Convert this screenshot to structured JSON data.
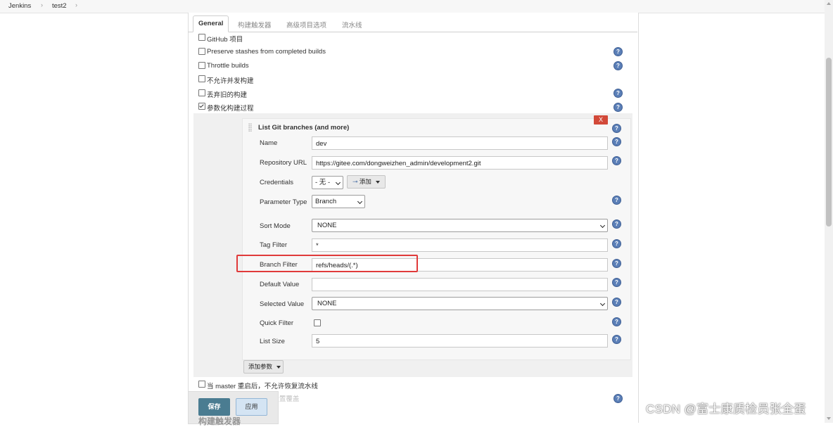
{
  "breadcrumb": [
    "Jenkins",
    "test2"
  ],
  "tabs": [
    "General",
    "构建触发器",
    "高级项目选项",
    "流水线"
  ],
  "options": [
    {
      "label": "GitHub 项目",
      "checked": false,
      "help": false
    },
    {
      "label": "Preserve stashes from completed builds",
      "checked": false,
      "help": true
    },
    {
      "label": "Throttle builds",
      "checked": false,
      "help": true
    },
    {
      "label": "不允许并发构建",
      "checked": false,
      "help": false
    },
    {
      "label": "丢弃旧的构建",
      "checked": false,
      "help": true
    },
    {
      "label": "参数化构建过程",
      "checked": true,
      "help": true
    }
  ],
  "parameter": {
    "title": "List Git branches (and more)",
    "delete_label": "X",
    "name_label": "Name",
    "name_value": "dev",
    "repo_label": "Repository URL",
    "repo_value": "https://gitee.com/dongweizhen_admin/development2.git",
    "credentials_label": "Credentials",
    "credentials_value": "- 无 -",
    "add_label": "添加",
    "type_label": "Parameter Type",
    "type_value": "Branch",
    "sort_label": "Sort Mode",
    "sort_value": "NONE",
    "tag_label": "Tag Filter",
    "tag_value": "*",
    "branch_label": "Branch Filter",
    "branch_value": "refs/heads/(.*)",
    "default_label": "Default Value",
    "default_value": "",
    "selected_label": "Selected Value",
    "selected_value": "NONE",
    "quick_label": "Quick Filter",
    "quick_checked": false,
    "listsize_label": "List Size",
    "listsize_value": "5"
  },
  "add_param_label": "添加参数",
  "after_options": [
    {
      "label": "当 master 重启后，不允许恢复流水线",
      "checked": false
    }
  ],
  "partial_row_text": "该项目为中...就是用中设置覆盖",
  "buttons": {
    "save": "保存",
    "apply": "应用"
  },
  "next_section": "构建触发器",
  "watermark": "CSDN @富士康质检员张全蛋",
  "colors": {
    "save_button": "#4a7c91",
    "delete_button": "#d24939",
    "highlight": "#e03a3a",
    "help_icon": "#5b7fb7"
  },
  "icons": [
    "help-icon",
    "key-icon",
    "drag-handle-icon",
    "chevron-down-icon"
  ]
}
